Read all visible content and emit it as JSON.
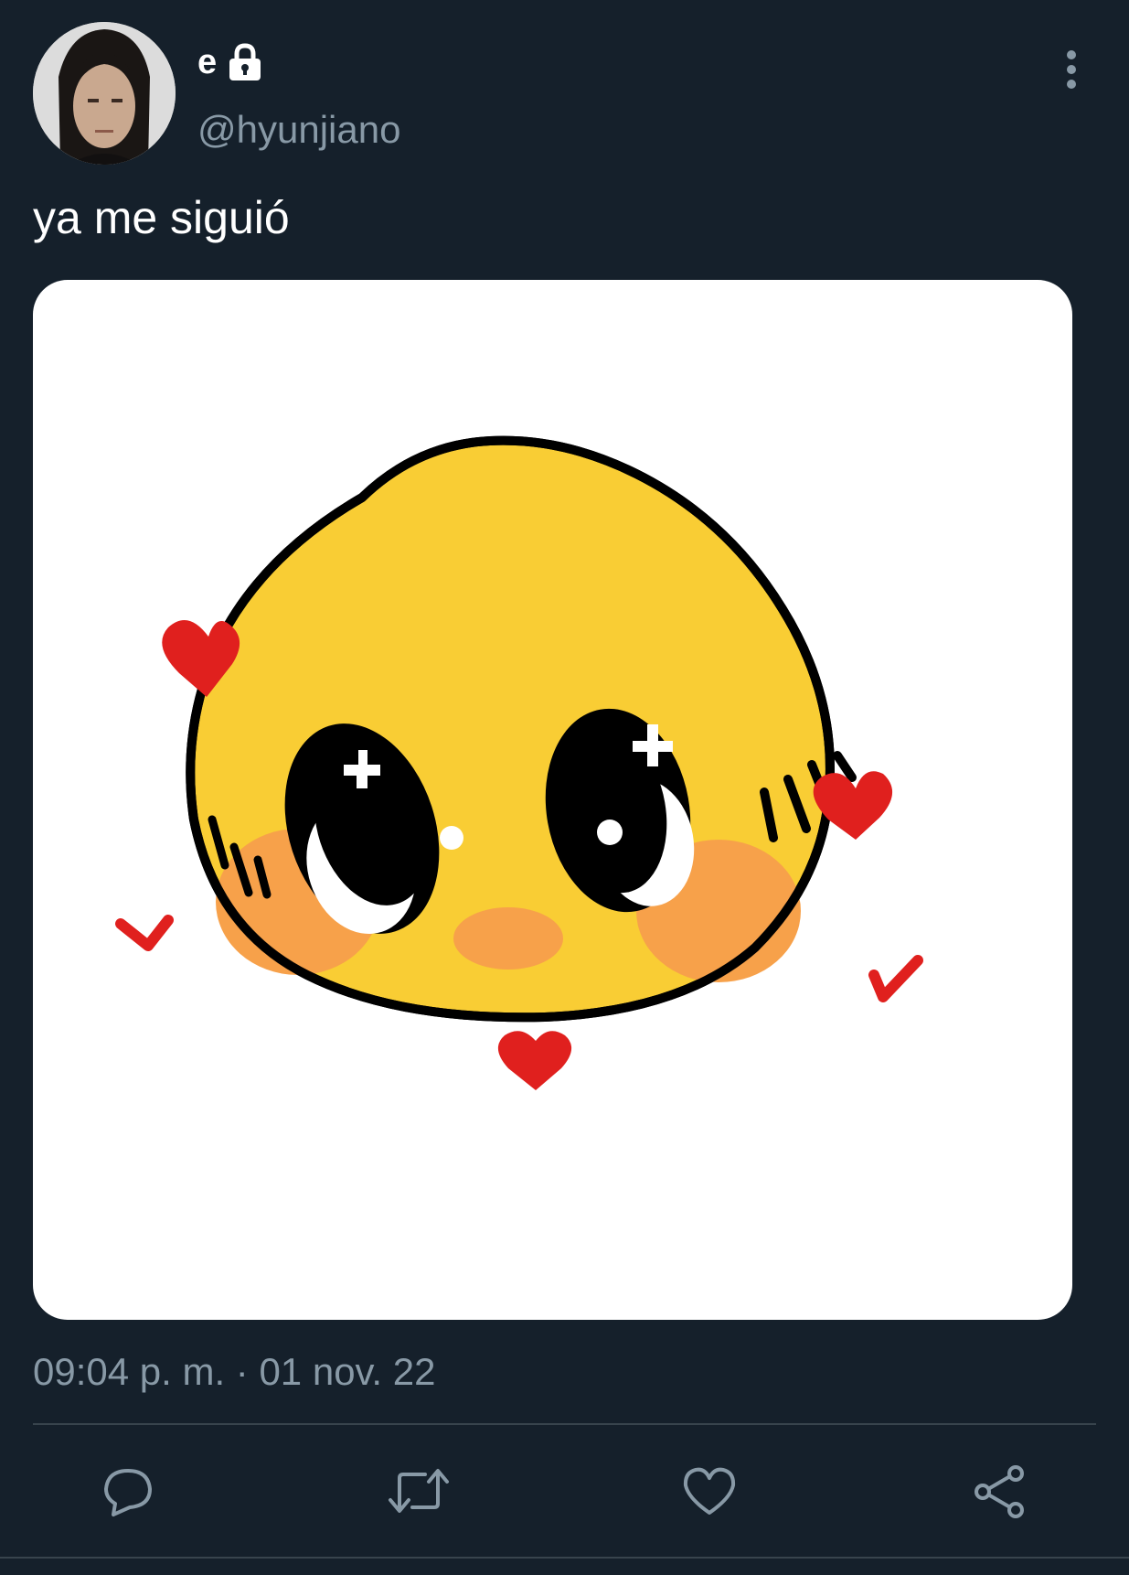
{
  "tweet": {
    "display_name": "e",
    "handle": "@hyunjiano",
    "text": "ya me siguió",
    "timestamp": "09:04 p. m. · 01 nov. 22",
    "protected_icon": "lock-icon",
    "media_description_icon": "pleading-blushing-face-with-hearts"
  },
  "actions": [
    {
      "name": "reply",
      "icon": "speech-bubble-icon"
    },
    {
      "name": "retweet",
      "icon": "retweet-icon"
    },
    {
      "name": "like",
      "icon": "heart-icon"
    },
    {
      "name": "share",
      "icon": "share-icon"
    }
  ],
  "colors": {
    "background": "#15202b",
    "secondary_text": "#8899a6",
    "divider": "#38444d",
    "emoji_yellow": "#f9cd34",
    "blush": "#f7a14a",
    "heart_red": "#e0201e"
  }
}
